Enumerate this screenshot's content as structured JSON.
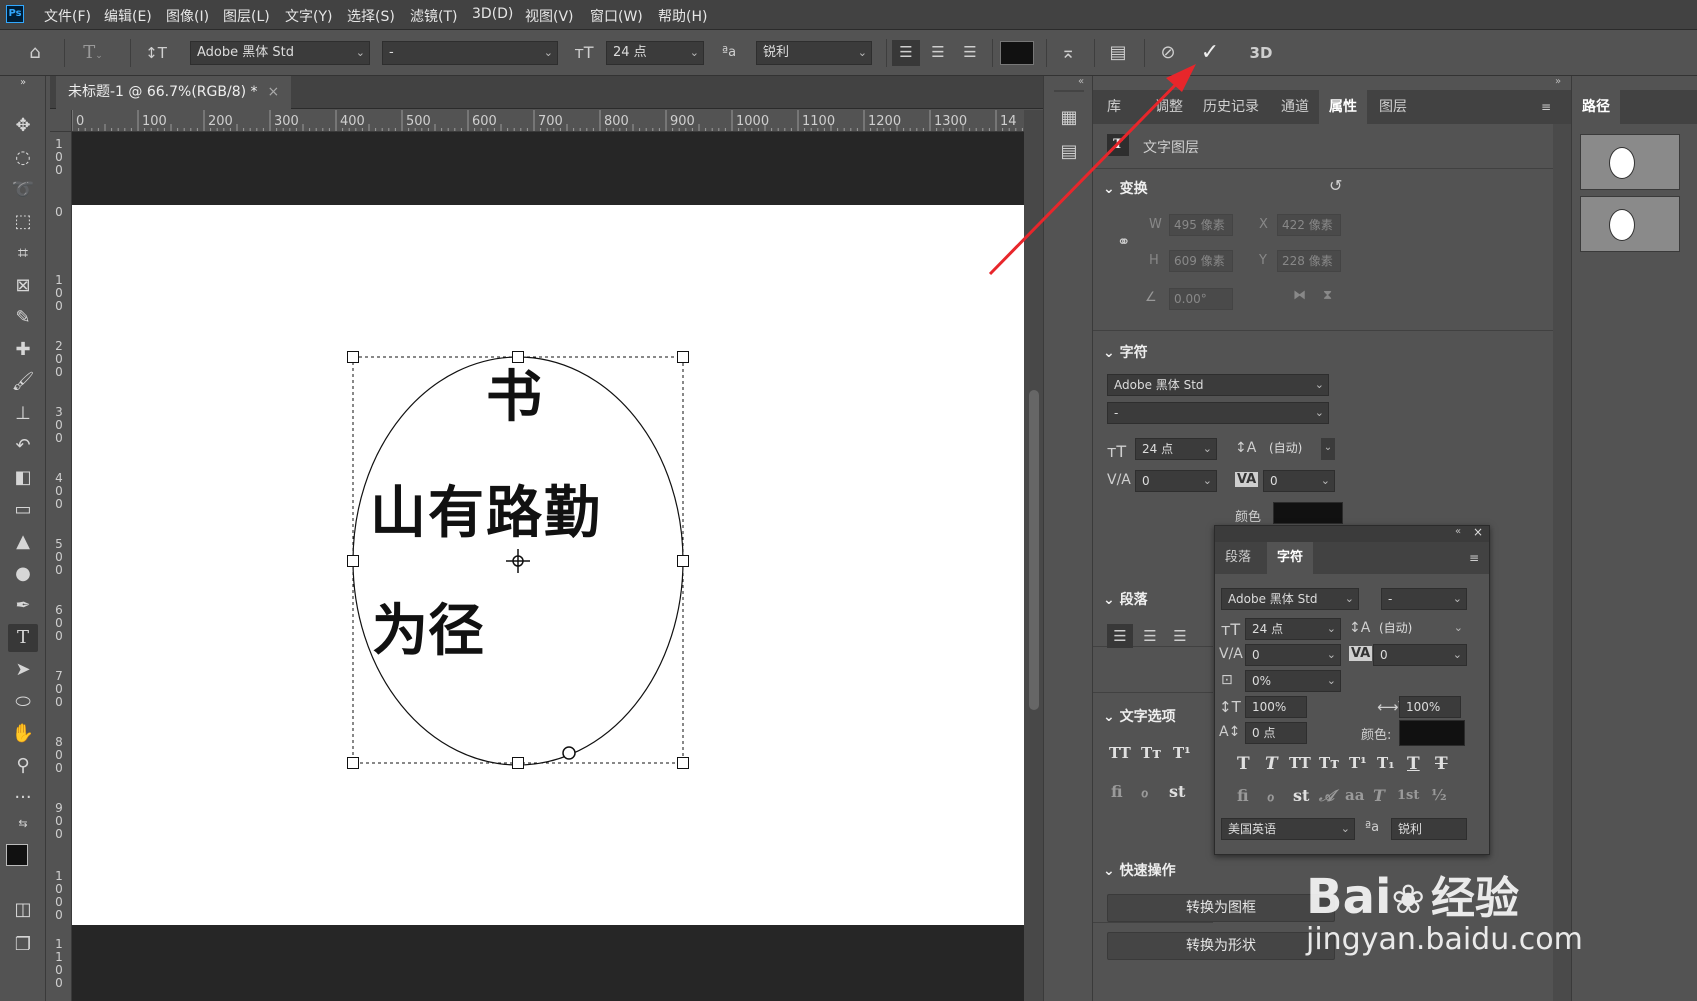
{
  "app": {
    "logo": "Ps"
  },
  "menu": [
    "文件(F)",
    "编辑(E)",
    "图像(I)",
    "图层(L)",
    "文字(Y)",
    "选择(S)",
    "滤镜(T)",
    "3D(D)",
    "视图(V)",
    "窗口(W)",
    "帮助(H)"
  ],
  "options": {
    "font_family": "Adobe 黑体 Std",
    "font_style": "-",
    "font_size": "24 点",
    "aa_label": "ªa",
    "antialias": "锐利",
    "text_color": "#111111",
    "threed_label": "3D"
  },
  "document": {
    "tab_title": "未标题-1 @ 66.7%(RGB/8) *",
    "ruler_h": [
      "0",
      "100",
      "200",
      "300",
      "400",
      "500",
      "600",
      "700",
      "800",
      "900",
      "1000",
      "1100",
      "1200",
      "1300",
      "14"
    ],
    "ruler_v": [
      "100",
      "0",
      "100",
      "200",
      "300",
      "400",
      "500",
      "600",
      "700",
      "800",
      "900",
      "1000",
      "1100"
    ],
    "canvas_text": [
      "书",
      "山有路勤",
      "为径"
    ]
  },
  "panel": {
    "tabs": [
      "库",
      "调整",
      "历史记录",
      "通道",
      "属性",
      "图层"
    ],
    "active_tab": "属性",
    "layer_type": "文字图层",
    "transform": {
      "title": "变换",
      "w_label": "W",
      "w": "495 像素",
      "x_label": "X",
      "x": "422 像素",
      "h_label": "H",
      "h": "609 像素",
      "y_label": "Y",
      "y": "228 像素",
      "angle": "0.00°"
    },
    "character": {
      "title": "字符",
      "font": "Adobe 黑体 Std",
      "style": "-",
      "size": "24 点",
      "leading": "(自动)",
      "kerning": "0",
      "tracking": "0",
      "color_label": "颜色"
    },
    "paragraph": {
      "title": "段落"
    },
    "text_options": {
      "title": "文字选项"
    },
    "quick_actions": {
      "title": "快速操作",
      "btn1": "转换为图框",
      "btn2": "转换为形状"
    }
  },
  "float_panel": {
    "tabs": [
      "段落",
      "字符"
    ],
    "font": "Adobe 黑体 Std",
    "style": "-",
    "size": "24 点",
    "leading": "(自动)",
    "kerning": "0",
    "tracking": "0",
    "tsume": "0%",
    "v_scale": "100%",
    "h_scale": "100%",
    "baseline": "0 点",
    "color_label": "颜色:",
    "language": "美国英语",
    "aa": "锐利"
  },
  "paths_panel": {
    "title": "路径"
  },
  "watermark": {
    "brand_left": "Bai",
    "brand_right": "经验",
    "url": "jingyan.baidu.com"
  },
  "colors": {
    "accent": "#31a8ff",
    "arrow": "#e8262b",
    "canvas": "#ffffff"
  }
}
